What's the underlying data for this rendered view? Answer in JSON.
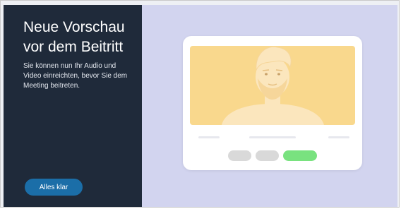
{
  "panel": {
    "title": "Neue Vorschau vor dem Beitritt",
    "description": "Sie können nun Ihr Audio und Video einreichten, bevor Sie dem Meeting beitreten.",
    "button_label": "Alles klar"
  },
  "illustration": {
    "video_bg_color": "#f9d88d",
    "controls": [
      {
        "name": "audio-toggle-button",
        "color": "#d9d9d9"
      },
      {
        "name": "video-toggle-button",
        "color": "#d9d9d9"
      },
      {
        "name": "join-button",
        "color": "#79e27f"
      }
    ]
  },
  "colors": {
    "sidebar_bg": "#1f2a3a",
    "accent_button": "#1b6ea8",
    "canvas_bg": "#d2d4ef"
  }
}
